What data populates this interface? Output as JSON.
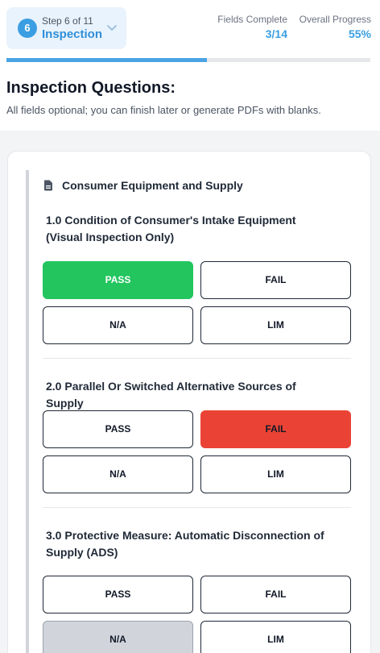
{
  "header": {
    "step_number": "6",
    "step_label": "Step 6 of 11",
    "step_name": "Inspection",
    "fields_complete_label": "Fields Complete",
    "fields_complete_value": "3/14",
    "overall_progress_label": "Overall Progress",
    "overall_progress_value": "55%",
    "progress_fraction": 0.55,
    "accent_color": "#3b9ee2"
  },
  "intro": {
    "title": "Inspection Questions:",
    "subtitle": "All fields optional; you can finish later or generate PDFs with blanks."
  },
  "section": {
    "icon": "document-icon",
    "title": "Consumer Equipment and Supply",
    "questions": [
      {
        "text": "1.0 Condition of Consumer's Intake Equipment (Visual Inspection Only)",
        "options": [
          "PASS",
          "FAIL",
          "N/A",
          "LIM"
        ],
        "selected": "PASS"
      },
      {
        "text": "2.0 Parallel Or Switched Alternative Sources of Supply",
        "options": [
          "PASS",
          "FAIL",
          "N/A",
          "LIM"
        ],
        "selected": "FAIL"
      },
      {
        "text": "3.0 Protective Measure: Automatic Disconnection of Supply (ADS)",
        "options": [
          "PASS",
          "FAIL",
          "N/A",
          "LIM"
        ],
        "selected": "N/A"
      }
    ]
  },
  "colors": {
    "pass": "#22c55e",
    "fail": "#ea4335",
    "na": "#d1d5db"
  }
}
